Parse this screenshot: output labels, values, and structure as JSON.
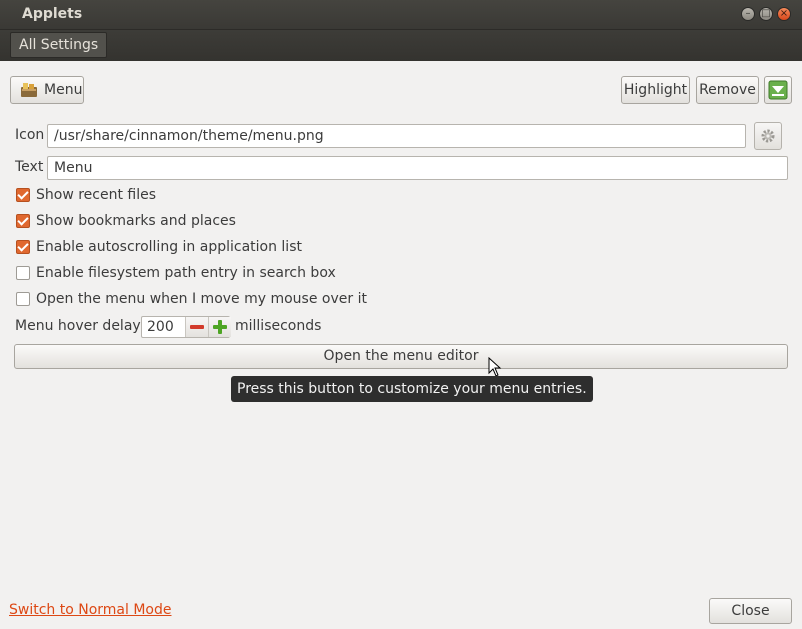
{
  "window": {
    "title": "Applets"
  },
  "toolbar": {
    "all_settings": "All Settings"
  },
  "applet": {
    "menu_label": "Menu",
    "highlight_label": "Highlight",
    "remove_label": "Remove"
  },
  "settings": {
    "icon_label": "Icon",
    "icon_value": "/usr/share/cinnamon/theme/menu.png",
    "text_label": "Text",
    "text_value": "Menu",
    "checkboxes": [
      {
        "label": "Show recent files",
        "checked": true
      },
      {
        "label": "Show bookmarks and places",
        "checked": true
      },
      {
        "label": "Enable autoscrolling in application list",
        "checked": true
      },
      {
        "label": "Enable filesystem path entry in search box",
        "checked": false
      },
      {
        "label": "Open the menu when I move my mouse over it",
        "checked": false
      }
    ],
    "hover_delay_label": "Menu hover delay:",
    "hover_delay_value": "200",
    "hover_delay_unit": "milliseconds",
    "editor_button": "Open the menu editor",
    "editor_tooltip": "Press this button to customize your menu entries."
  },
  "footer": {
    "switch_mode": "Switch to Normal Mode",
    "close_label": "Close"
  },
  "colors": {
    "accent": "#e0682f",
    "link": "#dd4814",
    "titlebar": "#3c3b37",
    "background": "#f2f1f0"
  },
  "icons": [
    "applet-menu-icon",
    "move-down-icon",
    "gear-icon",
    "minus-icon",
    "plus-icon",
    "mouse-cursor-icon"
  ]
}
